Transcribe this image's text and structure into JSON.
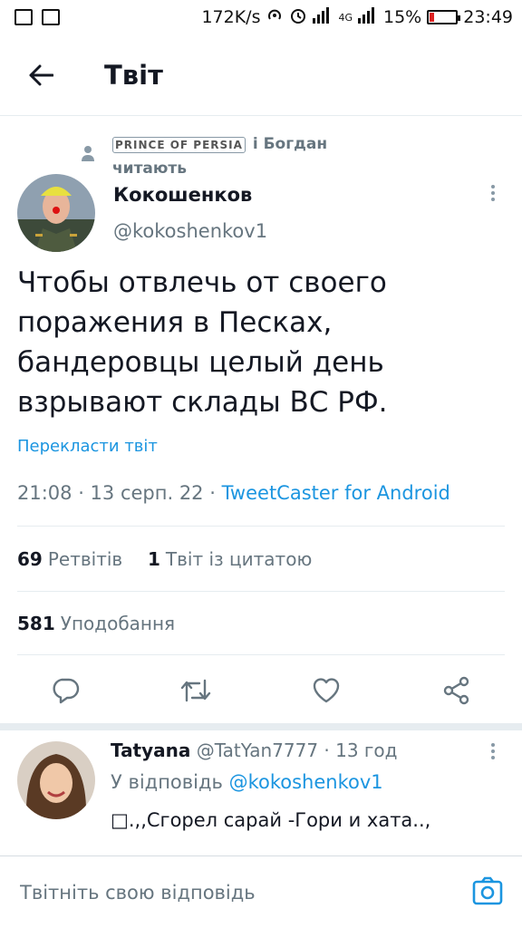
{
  "status_bar": {
    "speed": "172K/s",
    "network": "4G",
    "battery": "15%",
    "battery_level": 0.15,
    "time": "23:49"
  },
  "header": {
    "title": "Твіт"
  },
  "tweet": {
    "social_context": {
      "highlighted_name": "PRINCE OF PERSIA",
      "rest": " і Богдан",
      "line2": "читають"
    },
    "author_name": "Кокошенков",
    "author_handle": "@kokoshenkov1",
    "text": "Чтобы отвлечь от своего поражения в Песках, бандеровцы целый день взрывают склады ВС РФ.",
    "translate_label": "Перекласти твіт",
    "timestamp": "21:08 · 13 серп. 22 · ",
    "source": "TweetCaster for Android",
    "retweets_count": "69",
    "retweets_label": "Ретвітів",
    "quotes_count": "1",
    "quotes_label": "Твіт із цитатою",
    "likes_count": "581",
    "likes_label": "Уподобання"
  },
  "reply": {
    "name": "Tatyana",
    "handle": "@TatYan7777",
    "time": " · 13 год",
    "reply_to_label": "У відповідь ",
    "reply_to_handle": "@kokoshenkov1",
    "text": "□.,,Сгорел сарай -Гори и хата..,"
  },
  "compose": {
    "placeholder": "Твітніть свою відповідь"
  },
  "colors": {
    "accent": "#1b95e0",
    "secondary_text": "#66757f",
    "primary_text": "#141823",
    "divider": "#e6ecf0"
  },
  "icons": [
    "back-arrow-icon",
    "person-icon",
    "more-vertical-icon",
    "reply-icon",
    "retweet-icon",
    "like-icon",
    "share-icon",
    "camera-icon"
  ]
}
